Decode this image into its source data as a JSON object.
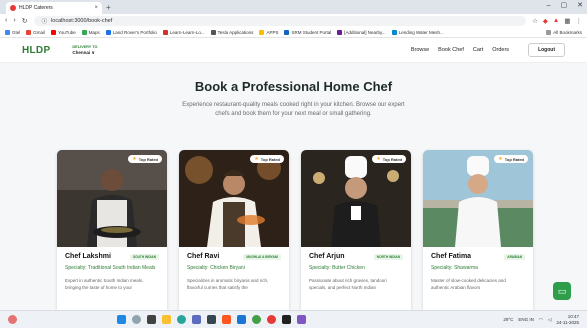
{
  "browser": {
    "tab_title": "HLDP Caterers",
    "url": "localhost:3000/book-chef",
    "bookmarks": [
      "Gtel",
      "Gmail",
      "YouTube",
      "Maps",
      "Land Rover's Portfolio",
      "Learn-Learn-Lo...",
      "Tesla Applications",
      "APPS",
      "SRM Student Portal",
      "[Additional] Nearby...",
      "Lending Water Mesh...",
      "All Bookmarks"
    ]
  },
  "nav": {
    "logo": "HLDP",
    "delivery_label": "DELIVERY TO",
    "delivery_city": "Chennai ∨",
    "links": [
      "Browse",
      "Book Chef",
      "Cart",
      "Orders"
    ],
    "logout": "Logout"
  },
  "hero": {
    "title": "Book a Professional Home Chef",
    "line1": "Experience restaurant-quality meals cooked right in your kitchen. Browse our expert",
    "line2": "chefs and book them for your next meal or small gathering."
  },
  "cards": [
    {
      "badge": "Top Rated",
      "name": "Chef Lakshmi",
      "tag": "South Indian",
      "specialty": "Specialty: Traditional South Indian Meals",
      "desc": "Expert in authentic South Indian meals, bringing the taste of home to your"
    },
    {
      "badge": "Top Rated",
      "name": "Chef Ravi",
      "tag": "Mughlai & Biryani",
      "specialty": "Specialty: Chicken Biryani",
      "desc": "Specializes in aromatic biryanis and rich, flavorful curries that satisfy the"
    },
    {
      "badge": "Top Rated",
      "name": "Chef Arjun",
      "tag": "North Indian",
      "specialty": "Specialty: Butter Chicken",
      "desc": "Passionate about rich gravies, tandoori specials, and perfect North Indian"
    },
    {
      "badge": "Top Rated",
      "name": "Chef Fatima",
      "tag": "Arabian",
      "specialty": "Specialty: Shawarma",
      "desc": "Master of slow-cooked delicacies and authentic Arabian flavors"
    }
  ],
  "taskbar": {
    "temp": "29°C",
    "lang": "ENG IN",
    "time": "10:47",
    "date": "24-11-2025"
  },
  "colors": {
    "brand": "#2e7d32",
    "chat": "#2e9e4a"
  }
}
